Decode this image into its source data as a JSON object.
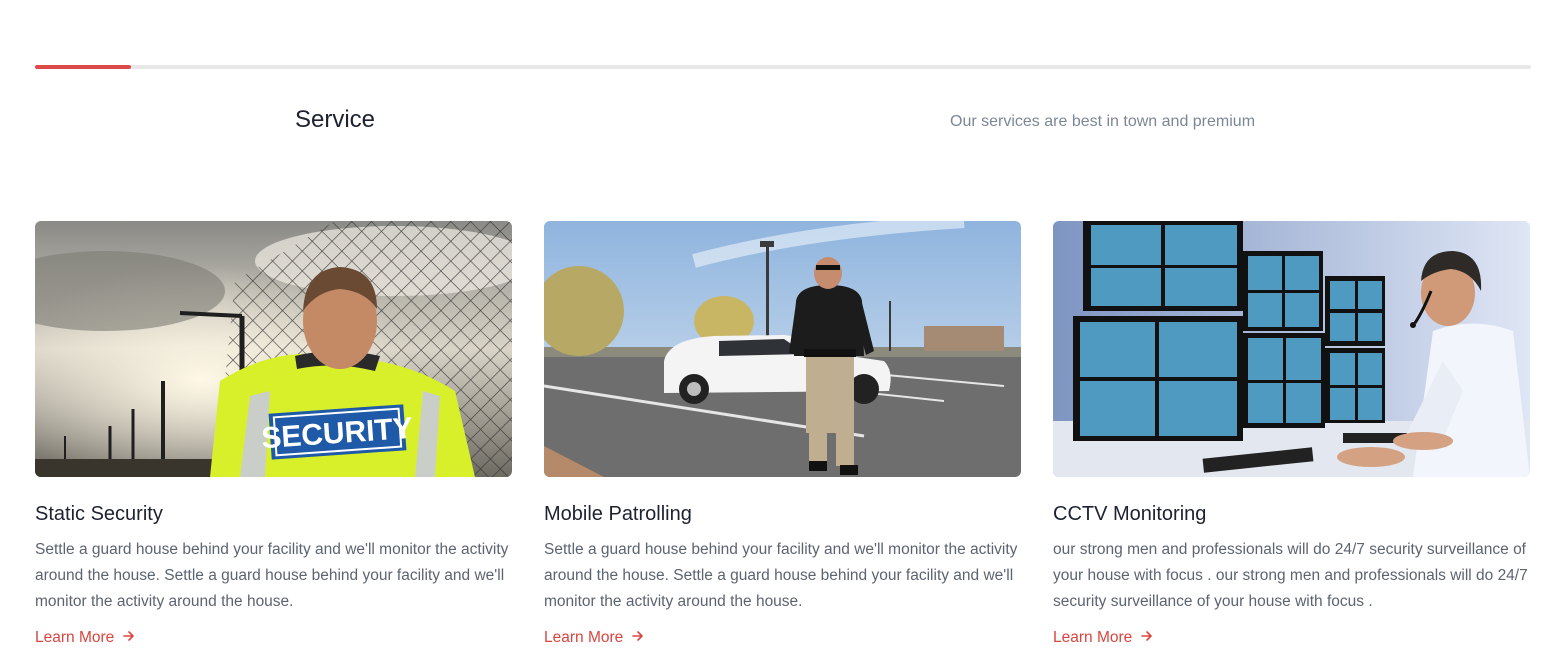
{
  "header": {
    "progress_percent": 6.4,
    "accent_color": "#dc4a4a",
    "title": "Service",
    "subtitle": "Our services are best in town and premium"
  },
  "cards": [
    {
      "title": "Static Security",
      "description": "Settle a guard house behind your facility and we'll monitor the activity around the house. Settle a guard house behind your facility and we'll monitor the activity around the house.",
      "link_label": "Learn More",
      "image_icon": "security-guard-photo",
      "vest_text": "SECURITY"
    },
    {
      "title": "Mobile Patrolling",
      "description": "Settle a guard house behind your facility and we'll monitor the activity around the house. Settle a guard house behind your facility and we'll monitor the activity around the house.",
      "link_label": "Learn More",
      "image_icon": "patrol-officer-photo"
    },
    {
      "title": "CCTV Monitoring",
      "description": "our strong men and professionals will do 24/7 security surveillance of your house with focus . our strong men and professionals will do 24/7 security surveillance of your house with focus .",
      "link_label": "Learn More",
      "image_icon": "cctv-operator-photo"
    }
  ]
}
